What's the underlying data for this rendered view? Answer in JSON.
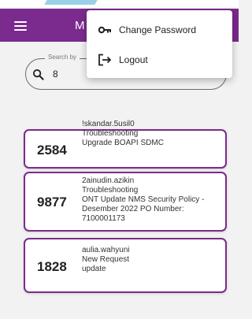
{
  "app_bar": {
    "title": "M"
  },
  "search": {
    "label": "Search by",
    "value": "8"
  },
  "menu": {
    "items": [
      {
        "label": "Change Password",
        "icon": "key-icon"
      },
      {
        "label": "Logout",
        "icon": "logout-icon"
      }
    ]
  },
  "cards": [
    {
      "number": "2584",
      "user": "!skandar.5usil0",
      "category": "Troubleshooting",
      "description": "Upgrade BOAPI SDMC"
    },
    {
      "number": "9877",
      "user": "2ainudin.azikin",
      "category": "Troubleshooting",
      "description": "ONT Update NMS Security Policy - Desember 2022 PO Number: 7100001173"
    },
    {
      "number": "1828",
      "user": "aulia.wahyuni",
      "category": "New Request",
      "description": "update"
    }
  ],
  "colors": {
    "accent": "#7b2a8e",
    "background": "#f2f2f2"
  }
}
